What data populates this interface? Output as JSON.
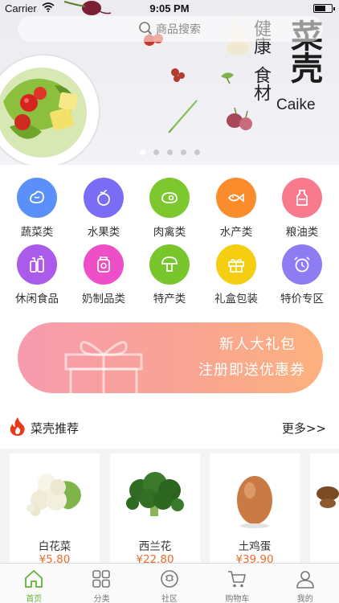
{
  "status_bar": {
    "carrier": "Carrier",
    "time": "9:05 PM"
  },
  "search": {
    "placeholder": "商品搜索"
  },
  "banner": {
    "brand_col1": "健康",
    "brand_col2": "食材",
    "brand_main": "菜壳",
    "brand_latin": "Caike",
    "dots_count": 5,
    "active_dot": 0
  },
  "categories": [
    {
      "label": "蔬菜类",
      "icon": "vegetable-icon",
      "color": "#5b8ff9"
    },
    {
      "label": "水果类",
      "icon": "fruit-icon",
      "color": "#7b6cf6"
    },
    {
      "label": "肉禽类",
      "icon": "meat-icon",
      "color": "#7cc82e"
    },
    {
      "label": "水产类",
      "icon": "seafood-icon",
      "color": "#fa8c2b"
    },
    {
      "label": "粮油类",
      "icon": "grain-oil-icon",
      "color": "#f77b8d"
    },
    {
      "label": "休闲食品",
      "icon": "snack-icon",
      "color": "#ab5bea"
    },
    {
      "label": "奶制品类",
      "icon": "dairy-icon",
      "color": "#ee4fc6"
    },
    {
      "label": "特产类",
      "icon": "specialty-icon",
      "color": "#79c52c"
    },
    {
      "label": "礼盒包装",
      "icon": "gift-box-icon",
      "color": "#f5ce12"
    },
    {
      "label": "特价专区",
      "icon": "alarm-clock-icon",
      "color": "#8e7cf3"
    }
  ],
  "promo": {
    "title": "新人大礼包",
    "subtitle": "注册即送优惠券"
  },
  "recommend": {
    "title": "菜壳推荐",
    "more": "更多>>",
    "items": [
      {
        "name": "白花菜",
        "price": "¥5.80",
        "icon": "cauliflower-image"
      },
      {
        "name": "西兰花",
        "price": "¥22.80",
        "icon": "broccoli-image"
      },
      {
        "name": "土鸡蛋",
        "price": "¥39.90",
        "icon": "egg-image"
      },
      {
        "name": "",
        "price": "",
        "icon": "mushroom-image"
      }
    ]
  },
  "tab_bar": [
    {
      "label": "首页",
      "icon": "home-icon",
      "active": true
    },
    {
      "label": "分类",
      "icon": "category-grid-icon",
      "active": false
    },
    {
      "label": "社区",
      "icon": "community-icon",
      "active": false
    },
    {
      "label": "购物车",
      "icon": "cart-icon",
      "active": false
    },
    {
      "label": "我的",
      "icon": "profile-icon",
      "active": false
    }
  ],
  "colors": {
    "accent_green": "#5fb336",
    "price_orange": "#f06a2b",
    "promo_start": "#f79bb0",
    "promo_end": "#fcb17e"
  }
}
